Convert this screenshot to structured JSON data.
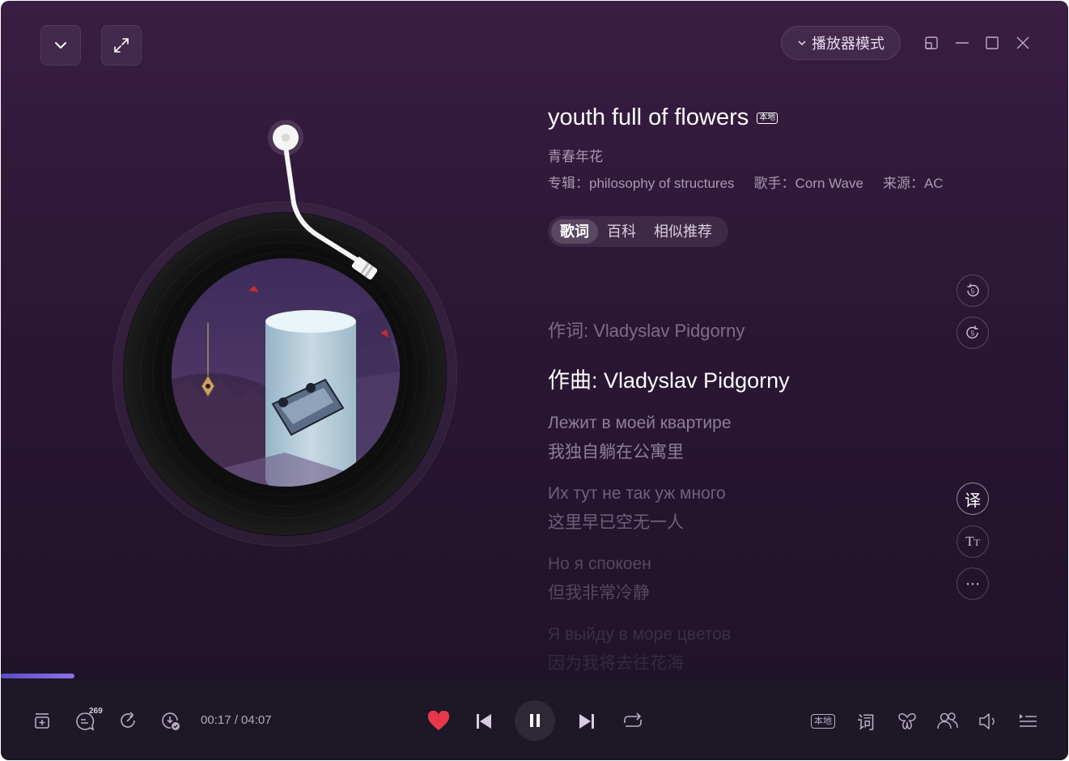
{
  "window": {
    "mode_label": "播放器模式"
  },
  "song": {
    "title": "youth full of flowers",
    "local_badge": "本地",
    "subtitle": "青春年花",
    "album": "专辑：philosophy of structures",
    "artist": "歌手：Corn Wave",
    "source": "来源：AC"
  },
  "tabs": [
    {
      "label": "歌词",
      "active": true
    },
    {
      "label": "百科",
      "active": false
    },
    {
      "label": "相似推荐",
      "active": false
    }
  ],
  "lyrics": [
    {
      "line": "作词: Vladyslav Pidgorny"
    },
    {
      "line": "作曲: Vladyslav Pidgorny",
      "current": true
    },
    {
      "line": "Лежит в моей квартире",
      "translation": "我独自躺在公寓里"
    },
    {
      "line": "Их тут не так уж много",
      "translation": "这里早已空无一人"
    },
    {
      "line": "Но я спокоен",
      "translation": "但我非常冷静"
    },
    {
      "line": "Я выйду в море цветов",
      "translation": "因为我将去往花海"
    }
  ],
  "side_buttons": {
    "rewind_5": "5",
    "forward_5": "5",
    "translate": "译",
    "font_size": "TT",
    "more": "⋯"
  },
  "playback": {
    "current_time": "00:17",
    "total_time": "04:07",
    "time_display": "00:17 / 04:07",
    "progress": 0.069,
    "comment_count": "269",
    "liked": true,
    "local_label": "本地",
    "lyrics_label": "词"
  },
  "colors": {
    "accent": "#6a58d6",
    "heart": "#e8364a",
    "background": "#2e1838"
  }
}
